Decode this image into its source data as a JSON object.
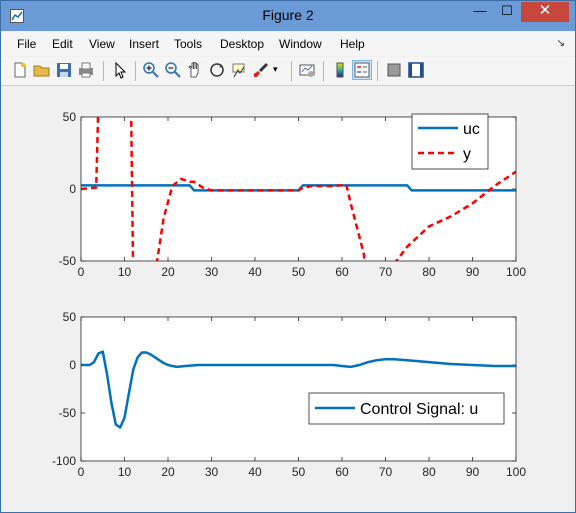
{
  "window": {
    "title": "Figure 2"
  },
  "menu": [
    "File",
    "Edit",
    "View",
    "Insert",
    "Tools",
    "Desktop",
    "Window",
    "Help"
  ],
  "toolbar": [
    "new-figure",
    "open-file",
    "save",
    "print",
    "edit-plot",
    "zoom-in",
    "zoom-out",
    "pan",
    "rotate-3d",
    "data-cursor",
    "brush",
    "link-plot",
    "insert-colorbar",
    "insert-legend",
    "hide-plot-tools",
    "show-plot-tools"
  ],
  "colors": {
    "series_blue": "#0072bd",
    "series_red": "#ff0000",
    "titlebar": "#6b9bd6",
    "close": "#c7463d"
  },
  "chart_data": [
    {
      "type": "line",
      "xlim": [
        0,
        100
      ],
      "ylim": [
        -50,
        50
      ],
      "xticks": [
        "0",
        "10",
        "20",
        "30",
        "40",
        "50",
        "60",
        "70",
        "80",
        "90",
        "100"
      ],
      "yticks": [
        "50",
        "0",
        "-50"
      ],
      "legend_location": "top-right",
      "series": [
        {
          "name": "uc",
          "style": "solid",
          "color": "#0072bd",
          "x": [
            0,
            25,
            26,
            50,
            51,
            75,
            76,
            100
          ],
          "y": [
            2.5,
            2.5,
            -1,
            -1,
            2.5,
            2.5,
            -1,
            -1
          ]
        },
        {
          "name": "y",
          "style": "dashed",
          "color": "#ff0000",
          "x": [
            0,
            2,
            3.5,
            4,
            4.5,
            11,
            11.5,
            12,
            16,
            17,
            19,
            21,
            23,
            25,
            26,
            28,
            30,
            50,
            51,
            53,
            58,
            61,
            62,
            65,
            67,
            70,
            72,
            75,
            80,
            85,
            90,
            95,
            100
          ],
          "y": [
            0,
            0.5,
            1,
            60,
            200,
            200,
            60,
            -60,
            -200,
            -60,
            -20,
            2,
            7,
            5,
            5,
            1,
            -1,
            -1,
            1,
            2,
            2,
            3,
            -10,
            -45,
            -120,
            -90,
            -52,
            -40,
            -26,
            -19,
            -10,
            2,
            12
          ]
        }
      ]
    },
    {
      "type": "line",
      "xlim": [
        0,
        100
      ],
      "ylim": [
        -100,
        50
      ],
      "xticks": [
        "0",
        "10",
        "20",
        "30",
        "40",
        "50",
        "60",
        "70",
        "80",
        "90",
        "100"
      ],
      "yticks": [
        "50",
        "0",
        "-50",
        "-100"
      ],
      "legend_location": "lower-right",
      "series": [
        {
          "name": "Control Signal: u",
          "style": "solid",
          "color": "#0072bd",
          "x": [
            0,
            2,
            3,
            4,
            5,
            6,
            7,
            8,
            9,
            10,
            11,
            12,
            13,
            14,
            15,
            16,
            17,
            18,
            19,
            20,
            21,
            22,
            24,
            27,
            30,
            40,
            50,
            58,
            60,
            62,
            64,
            66,
            68,
            70,
            72,
            75,
            80,
            85,
            90,
            95,
            100
          ],
          "y": [
            0,
            0,
            3,
            12,
            14,
            -10,
            -40,
            -62,
            -65,
            -55,
            -30,
            -5,
            8,
            13,
            13,
            11,
            8,
            5,
            2,
            0,
            -1,
            -2,
            -1,
            0,
            0,
            0,
            0,
            0,
            -1,
            -2,
            0,
            3,
            5,
            6,
            6,
            5,
            3,
            1,
            0,
            -1,
            -1
          ]
        }
      ]
    }
  ]
}
